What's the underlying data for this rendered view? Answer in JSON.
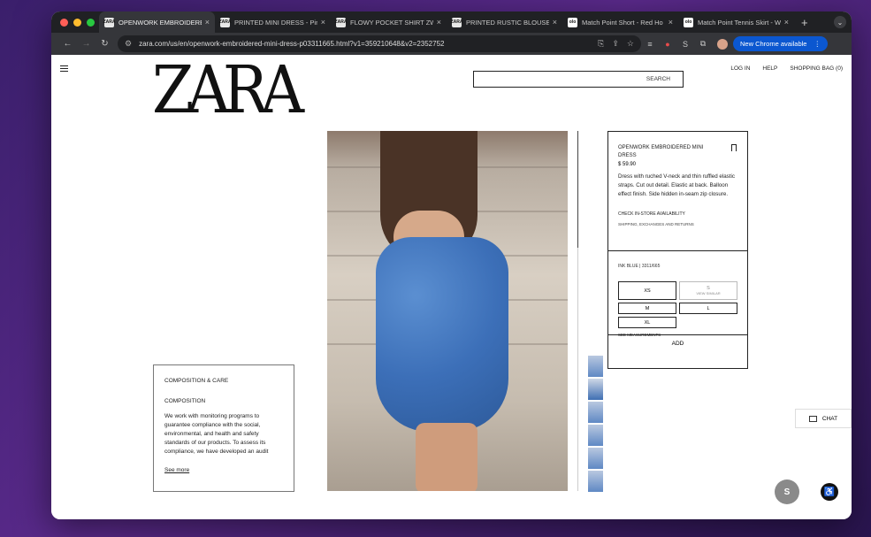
{
  "browser": {
    "tabs": [
      {
        "favicon": "ZARA",
        "title": "OPENWORK EMBROIDERED",
        "active": true
      },
      {
        "favicon": "ZARA",
        "title": "PRINTED MINI DRESS - Pink",
        "active": false
      },
      {
        "favicon": "ZARA",
        "title": "FLOWY POCKET SHIRT ZW",
        "active": false
      },
      {
        "favicon": "ZARA",
        "title": "PRINTED RUSTIC BLOUSE",
        "active": false
      },
      {
        "favicon": "olo",
        "title": "Match Point Short - Red Ho",
        "active": false
      },
      {
        "favicon": "olo",
        "title": "Match Point Tennis Skirt - W",
        "active": false
      }
    ],
    "url": "zara.com/us/en/openwork-embroidered-mini-dress-p03311665.html?v1=359210648&v2=2352752",
    "new_chrome_label": "New Chrome available"
  },
  "header": {
    "logo": "ZARA",
    "search_label": "SEARCH",
    "nav": {
      "login": "LOG IN",
      "help": "HELP",
      "bag": "SHOPPING BAG (0)"
    }
  },
  "product": {
    "name": "OPENWORK EMBROIDERED MINI DRESS",
    "price": "$ 59.90",
    "description": "Dress with ruched V-neck and thin ruffled elastic straps. Cut out detail. Elastic at back. Balloon effect finish. Side hidden in-seam zip closure.",
    "check_store": "CHECK IN-STORE AVAILABILITY",
    "shipping": "SHIPPING, EXCHANGES AND RETURNS",
    "color_ref": "INK BLUE | 3311/665",
    "sizes": {
      "xs": "XS",
      "s": "S",
      "s_note": "VIEW SIMILAR",
      "m": "M",
      "l": "L",
      "xl": "XL"
    },
    "see_measurements": "SEE MEASUREMENTS",
    "add_label": "ADD"
  },
  "composition": {
    "heading": "COMPOSITION & CARE",
    "subheading": "COMPOSITION",
    "body": "We work with monitoring programs to guarantee compliance with the social, environmental, and health and safety standards of our products. To assess its compliance, we have developed an audit",
    "see_more": "See more"
  },
  "chat_label": "CHAT",
  "colors": {
    "accent": "#0b57d0",
    "chrome_dark": "#202124",
    "chrome_mid": "#35363a"
  }
}
